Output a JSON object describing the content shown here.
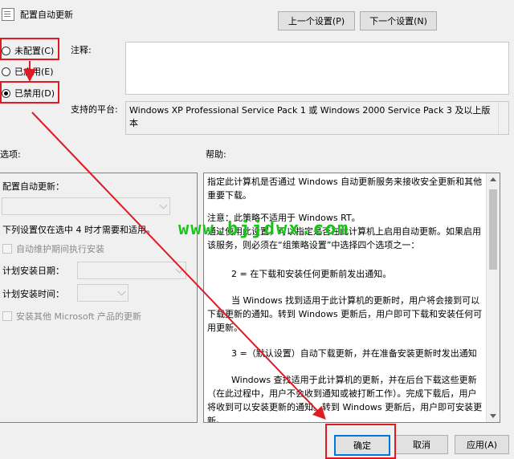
{
  "window": {
    "title": "配置自动更新",
    "icon": "policy-setting-icon"
  },
  "nav": {
    "prev_label": "上一个设置(P)",
    "next_label": "下一个设置(N)"
  },
  "state": {
    "options": [
      {
        "label": "未配置(C)",
        "selected": false
      },
      {
        "label": "已启用(E)",
        "selected": false
      },
      {
        "label": "已禁用(D)",
        "selected": true
      }
    ]
  },
  "comment": {
    "label": "注释:",
    "value": ""
  },
  "platform": {
    "label": "支持的平台:",
    "value": "Windows XP Professional Service Pack 1 或 Windows 2000 Service Pack 3 及以上版本"
  },
  "options_section": {
    "label": "选项:",
    "configure_label": "配置自动更新：",
    "configure_value": "",
    "note": "下列设置仅在选中 4 时才需要和适用。",
    "maintenance_label": "自动维护期间执行安装",
    "schedule_day_label": "计划安装日期：",
    "schedule_day_value": "",
    "schedule_time_label": "计划安装时间：",
    "schedule_time_value": "",
    "other_products_label": "安装其他 Microsoft 产品的更新"
  },
  "help": {
    "label": "帮助:",
    "paragraphs": [
      "指定此计算机是否通过 Windows 自动更新服务来接收安全更新和其他重要下载。",
      "注意：此策略不适用于 Windows RT。",
      "通过使用此设置，可以指定是否在此计算机上启用自动更新。如果启用该服务，则必须在“组策略设置”中选择四个选项之一：",
      "2 = 在下载和安装任何更新前发出通知。",
      "当 Windows 找到适用于此计算机的更新时，用户将会接到可以下载更新的通知。转到 Windows 更新后，用户即可下载和安装任何可用更新。",
      "3 =（默认设置）自动下载更新，并在准备安装更新时发出通知",
      "Windows 查找适用于此计算机的更新，并在后台下载这些更新（在此过程中，用户不会收到通知或被打断工作）。完成下载后，用户将收到可以安装更新的通知。转到 Windows 更新后，用户即可安装更新。"
    ]
  },
  "footer": {
    "ok_label": "确定",
    "cancel_label": "取消",
    "apply_label": "应用(A)"
  },
  "watermark": "www.bjjdwx.com",
  "colors": {
    "highlight": "#e01a22",
    "watermark": "#18c418",
    "focus": "#0078d7"
  }
}
